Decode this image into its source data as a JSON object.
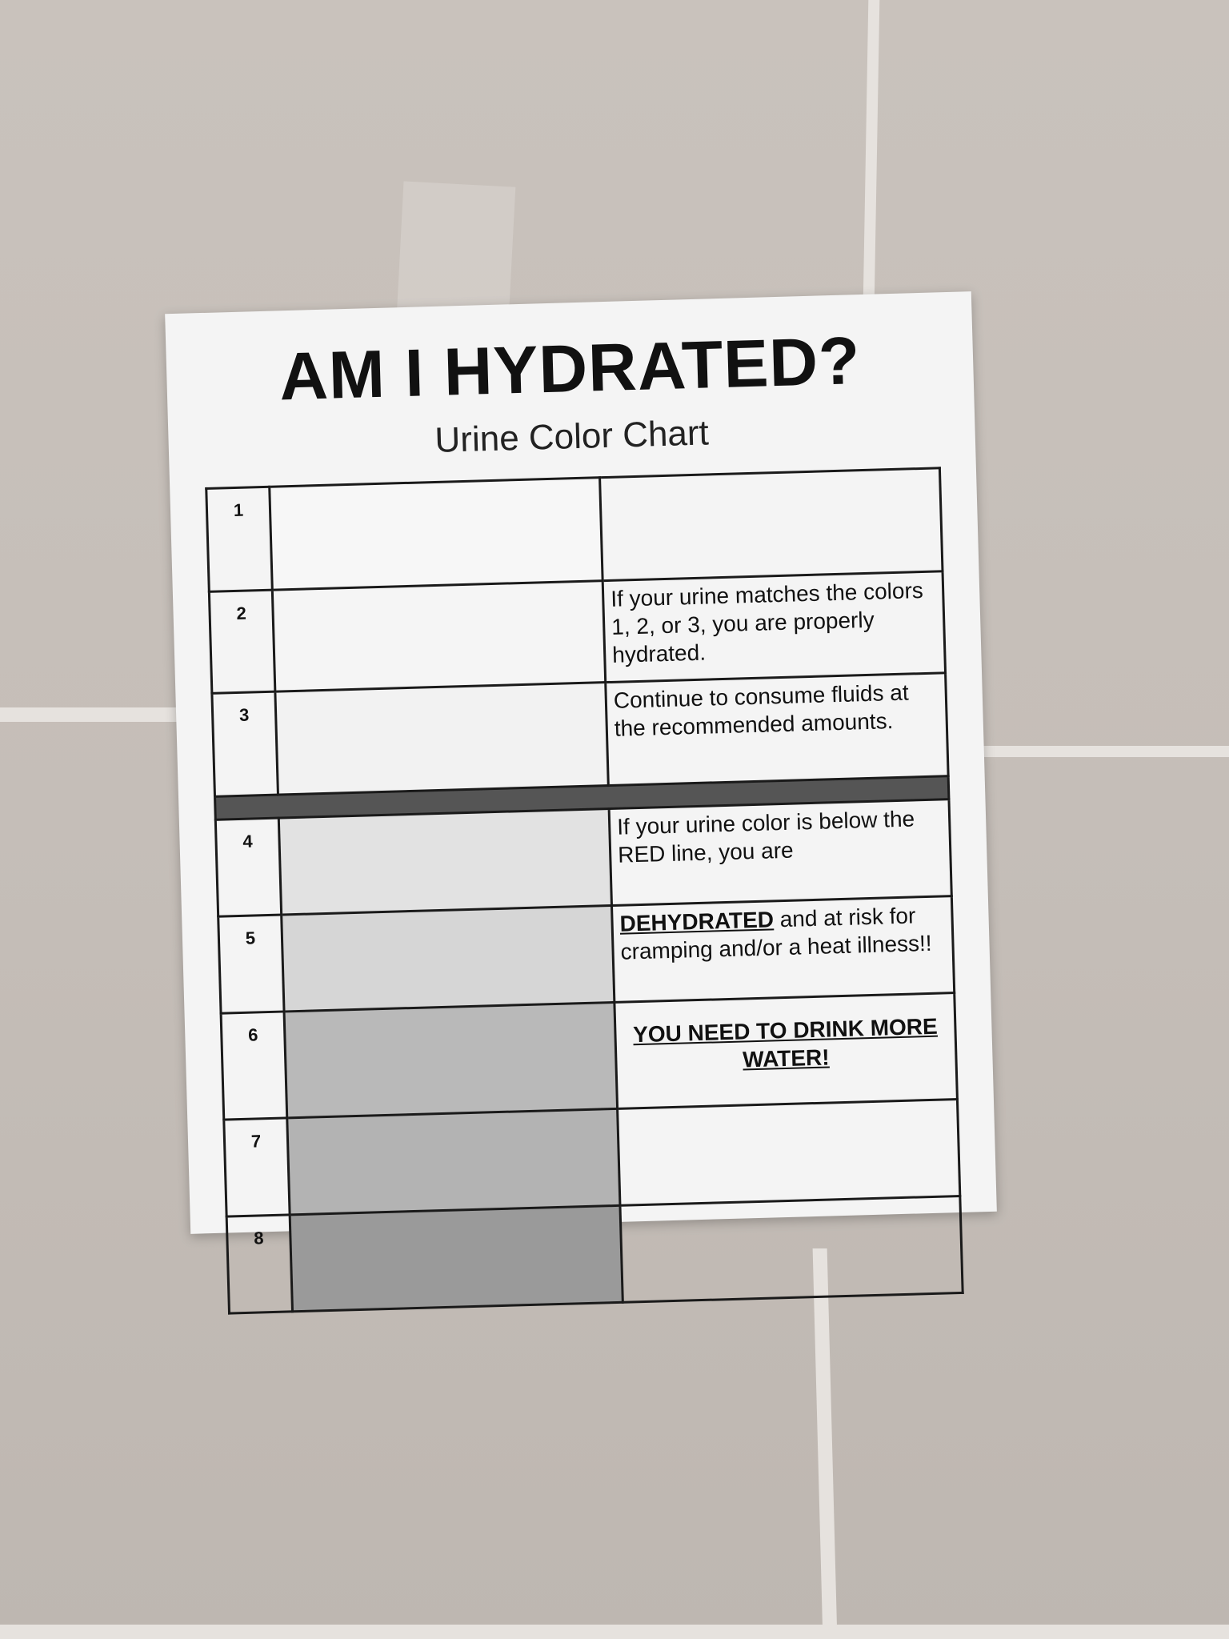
{
  "poster": {
    "title": "AM I HYDRATED?",
    "subtitle": "Urine Color Chart"
  },
  "rows": [
    {
      "number": "1",
      "swatch_color": "#f7f7f7"
    },
    {
      "number": "2",
      "swatch_color": "#f5f5f5"
    },
    {
      "number": "3",
      "swatch_color": "#f2f2f2"
    },
    {
      "number": "4",
      "swatch_color": "#e2e2e2"
    },
    {
      "number": "5",
      "swatch_color": "#d6d6d6"
    },
    {
      "number": "6",
      "swatch_color": "#b9b9b9"
    },
    {
      "number": "7",
      "swatch_color": "#b3b3b3"
    },
    {
      "number": "8",
      "swatch_color": "#9a9a9a"
    }
  ],
  "notes": {
    "hydrated_1": "If your urine matches the colors 1, 2, or 3, you are properly hydrated.",
    "hydrated_2": "Continue to consume fluids at the recommended amounts.",
    "below_line": "If your urine color is below the RED line, you are",
    "dehydrated_word": "DEHYDRATED",
    "dehydrated_rest": " and at risk for cramping and/or a heat illness!!",
    "drink_more": "YOU NEED TO DRINK MORE WATER!"
  },
  "colors": {
    "separator_line": "#555555",
    "wall": "#c9c2bc",
    "paper": "#f4f4f4"
  }
}
